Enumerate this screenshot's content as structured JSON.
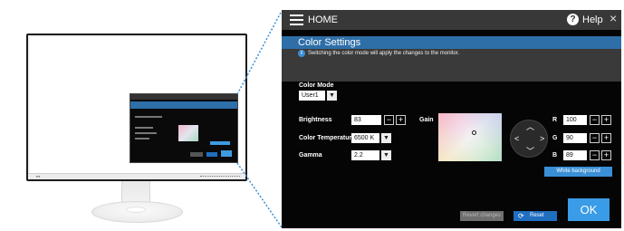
{
  "header": {
    "home_label": "HOME",
    "help_label": "Help",
    "close_glyph": "×"
  },
  "page": {
    "title": "Color Settings",
    "info_text": "Switching the color mode will apply the changes to the monitor."
  },
  "color_mode": {
    "label": "Color Mode",
    "value": "User1"
  },
  "brightness": {
    "label": "Brightness",
    "value": "83"
  },
  "color_temperature": {
    "label": "Color Temperature",
    "value": "6500 K"
  },
  "gamma": {
    "label": "Gamma",
    "value": "2.2"
  },
  "gain": {
    "label": "Gain",
    "r_label": "R",
    "r_value": "100",
    "g_label": "G",
    "g_value": "90",
    "b_label": "B",
    "b_value": "89"
  },
  "buttons": {
    "minus": "−",
    "plus": "+",
    "dropdown": "▼",
    "white_background": "White background",
    "revert_changes": "Revert changes",
    "reset": "Reset",
    "ok": "OK"
  },
  "colors": {
    "accent": "#3a8fd6",
    "title_band": "#2f6fa8",
    "osd_bg": "#050505",
    "ok_button": "#3a9be6"
  },
  "icons": [
    "menu-icon",
    "help-icon",
    "close-icon",
    "info-icon",
    "dpad-icon",
    "reset-icon"
  ]
}
